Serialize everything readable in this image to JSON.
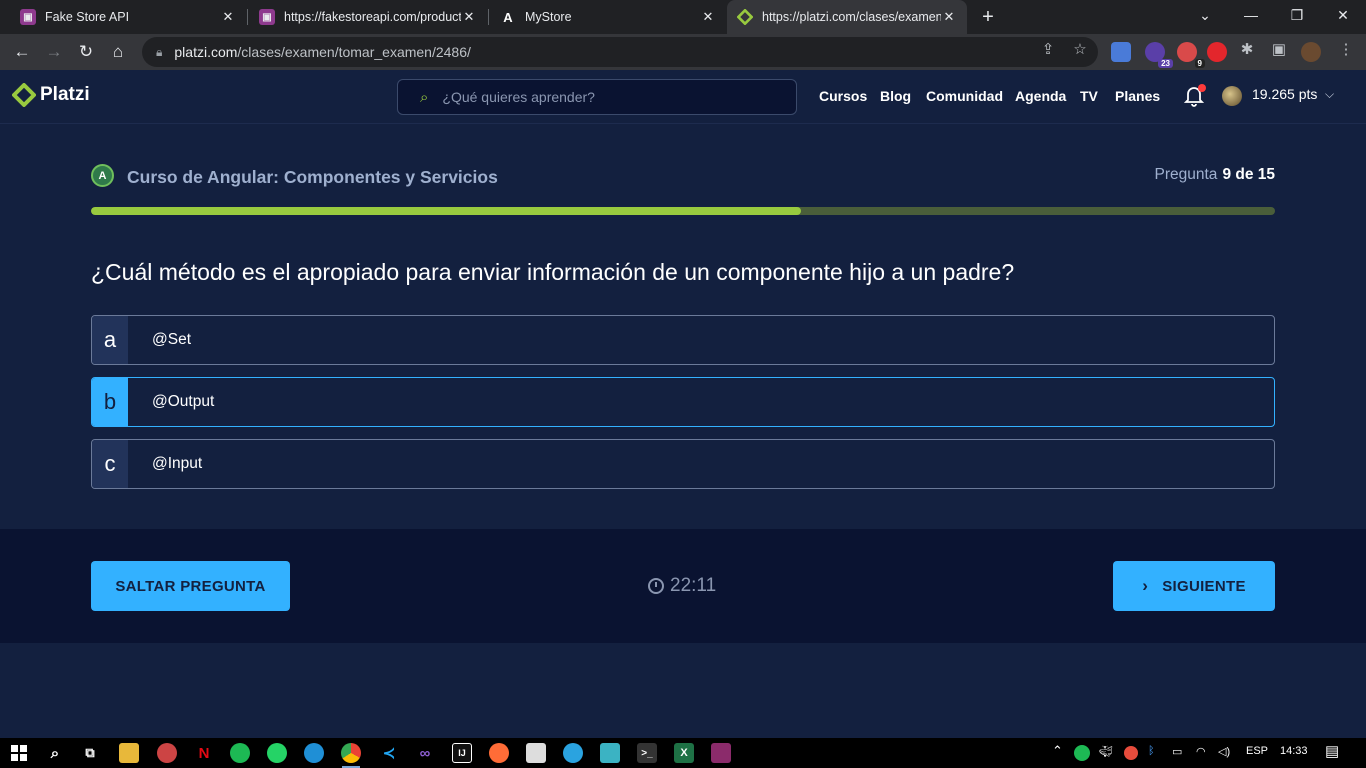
{
  "browser": {
    "tabs": [
      {
        "title": "Fake Store API",
        "active": false
      },
      {
        "title": "https://fakestoreapi.com/product",
        "active": false
      },
      {
        "title": "MyStore",
        "active": false
      },
      {
        "title": "https://platzi.com/clases/examen",
        "active": true
      }
    ],
    "url_host": "platzi.com",
    "url_path": "/clases/examen/tomar_examen/2486/",
    "ext_badges": {
      "first": "23",
      "second": "9"
    }
  },
  "header": {
    "logo_text": "Platzi",
    "search_placeholder": "¿Qué quieres aprender?",
    "nav": [
      "Cursos",
      "Blog",
      "Comunidad",
      "Agenda",
      "TV",
      "Planes"
    ],
    "points": "19.265 pts"
  },
  "exam": {
    "course_title": "Curso de Angular: Componentes y Servicios",
    "question_label": "Pregunta",
    "question_progress": "9 de 15",
    "progress_fraction": 0.6,
    "question": "¿Cuál método es el apropiado para enviar información de un componente hijo a un padre?",
    "answers": [
      {
        "letter": "a",
        "text": "@Set",
        "selected": false
      },
      {
        "letter": "b",
        "text": "@Output",
        "selected": true
      },
      {
        "letter": "c",
        "text": "@Input",
        "selected": false
      }
    ],
    "skip_label": "SALTAR PREGUNTA",
    "timer": "22:11",
    "next_label": "SIGUIENTE"
  },
  "taskbar": {
    "language": "ESP",
    "time": "14:33"
  },
  "colors": {
    "accent_green": "#98ca3f",
    "accent_blue": "#33b1ff",
    "background": "#13203f"
  }
}
